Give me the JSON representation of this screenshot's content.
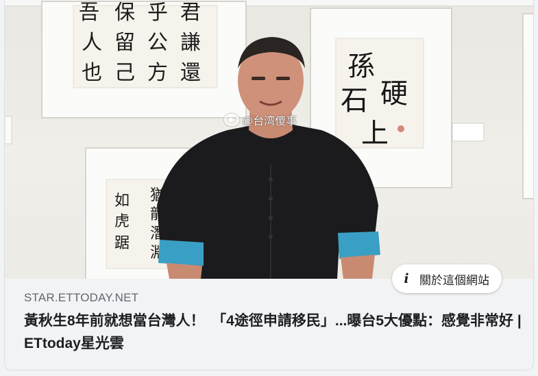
{
  "post": {
    "photo": {
      "watermark": "@台湾傻事",
      "watermark_icon": "weibo-icon",
      "calligraphy_left_top": [
        "吾",
        "保",
        "乎",
        "君",
        "人",
        "留",
        "公",
        "謙",
        "也",
        "己",
        "方",
        "還"
      ],
      "calligraphy_right_top": [
        "孫",
        "石",
        "硬",
        "上"
      ],
      "calligraphy_left_bottom": [
        "如",
        "虎",
        "踞",
        "猶",
        "龍",
        "潛",
        "淵"
      ]
    },
    "about_button": {
      "icon": "info-icon",
      "label": "關於這個網站"
    },
    "link": {
      "domain": "STAR.ETTODAY.NET",
      "title": "黃秋生8年前就想當台灣人！　「4途徑申請移民」...曝台5大優點：感覺非常好 | ETtoday星光雲"
    }
  },
  "colors": {
    "background": "#f2f3f5",
    "title_text": "#1c1e21",
    "meta_text": "#606770",
    "shirt": "#1b1b1d",
    "cuff": "#3a9fc4"
  }
}
